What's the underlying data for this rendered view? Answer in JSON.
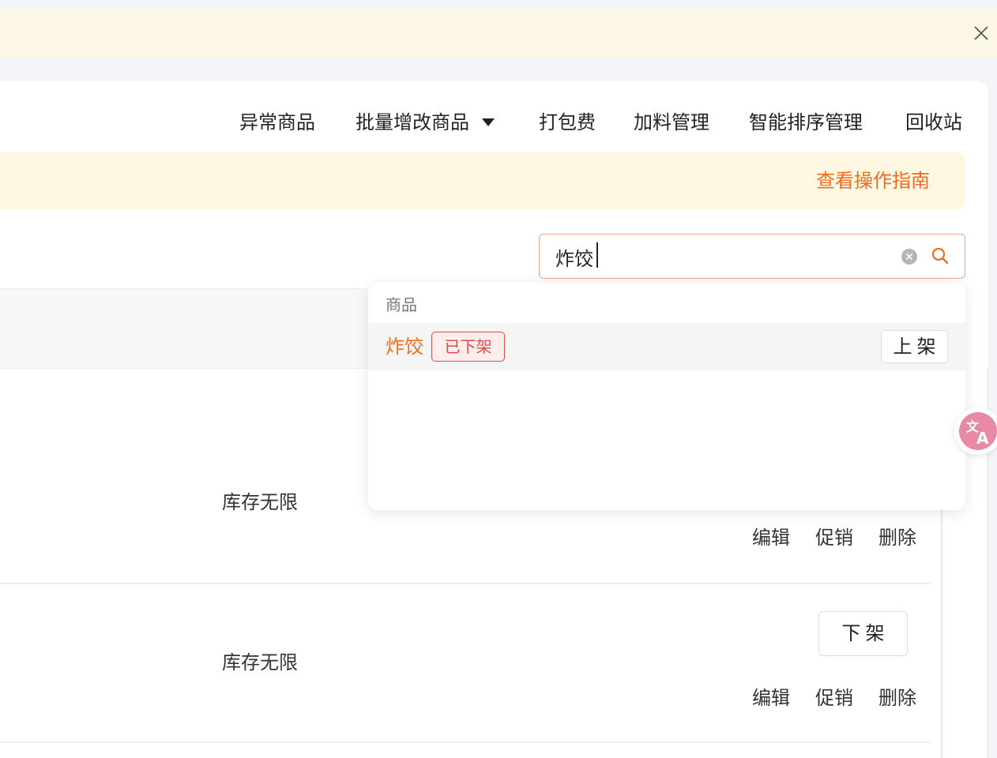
{
  "tabs": [
    {
      "label": "异常商品"
    },
    {
      "label": "批量增改商品"
    },
    {
      "label": "打包费"
    },
    {
      "label": "加料管理"
    },
    {
      "label": "智能排序管理"
    },
    {
      "label": "回收站"
    }
  ],
  "notice": {
    "guide_link": "查看操作指南"
  },
  "search": {
    "value": "炸饺"
  },
  "dropdown": {
    "section_title": "商品",
    "item": {
      "name": "炸饺",
      "status": "已下架",
      "action": "上架"
    }
  },
  "rows": [
    {
      "stock": "库存无限",
      "actions": [
        "编辑",
        "促销",
        "删除"
      ]
    },
    {
      "stock": "库存无限",
      "shelf_action": "下架",
      "actions": [
        "编辑",
        "促销",
        "删除"
      ]
    }
  ],
  "icons": {
    "banner_close": "close-icon",
    "clear": "clear-icon",
    "search": "search-icon",
    "translate": "translate-icon"
  },
  "colors": {
    "accent": "#f06b1f",
    "badge_red": "#e24b4b",
    "banner_bg": "#fdf7e6"
  }
}
